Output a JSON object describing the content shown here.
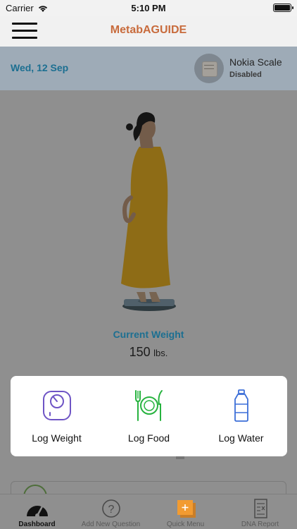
{
  "status_bar": {
    "carrier": "Carrier",
    "time": "5:10 PM"
  },
  "navbar": {
    "title": "MetabAGUIDE",
    "menu_icon": "hamburger-menu-icon"
  },
  "date_band": {
    "date": "Wed, 12 Sep",
    "scale_name": "Nokia Scale",
    "scale_status": "Disabled",
    "scale_icon": "scale-icon"
  },
  "weight": {
    "label": "Current Weight",
    "value": "150",
    "unit": "lbs."
  },
  "quick_menu": {
    "items": [
      {
        "label": "Log Weight",
        "icon": "scale-icon"
      },
      {
        "label": "Log Food",
        "icon": "plate-fork-knife-icon"
      },
      {
        "label": "Log Water",
        "icon": "water-bottle-icon"
      }
    ]
  },
  "tabbar": {
    "tabs": [
      {
        "label": "Dashboard",
        "icon": "speedometer-icon",
        "active": true
      },
      {
        "label": "Add New Question",
        "icon": "question-circle-icon",
        "active": false
      },
      {
        "label": "Quick Menu",
        "icon": "plus-square-icon",
        "active": false
      },
      {
        "label": "DNA Report",
        "icon": "report-document-icon",
        "active": false
      }
    ]
  },
  "colors": {
    "accent_orange": "#c86b3c",
    "accent_blue": "#1c6f91",
    "food_green": "#27b33f",
    "weight_purple": "#6e54c5",
    "water_blue": "#3c6fd8"
  }
}
